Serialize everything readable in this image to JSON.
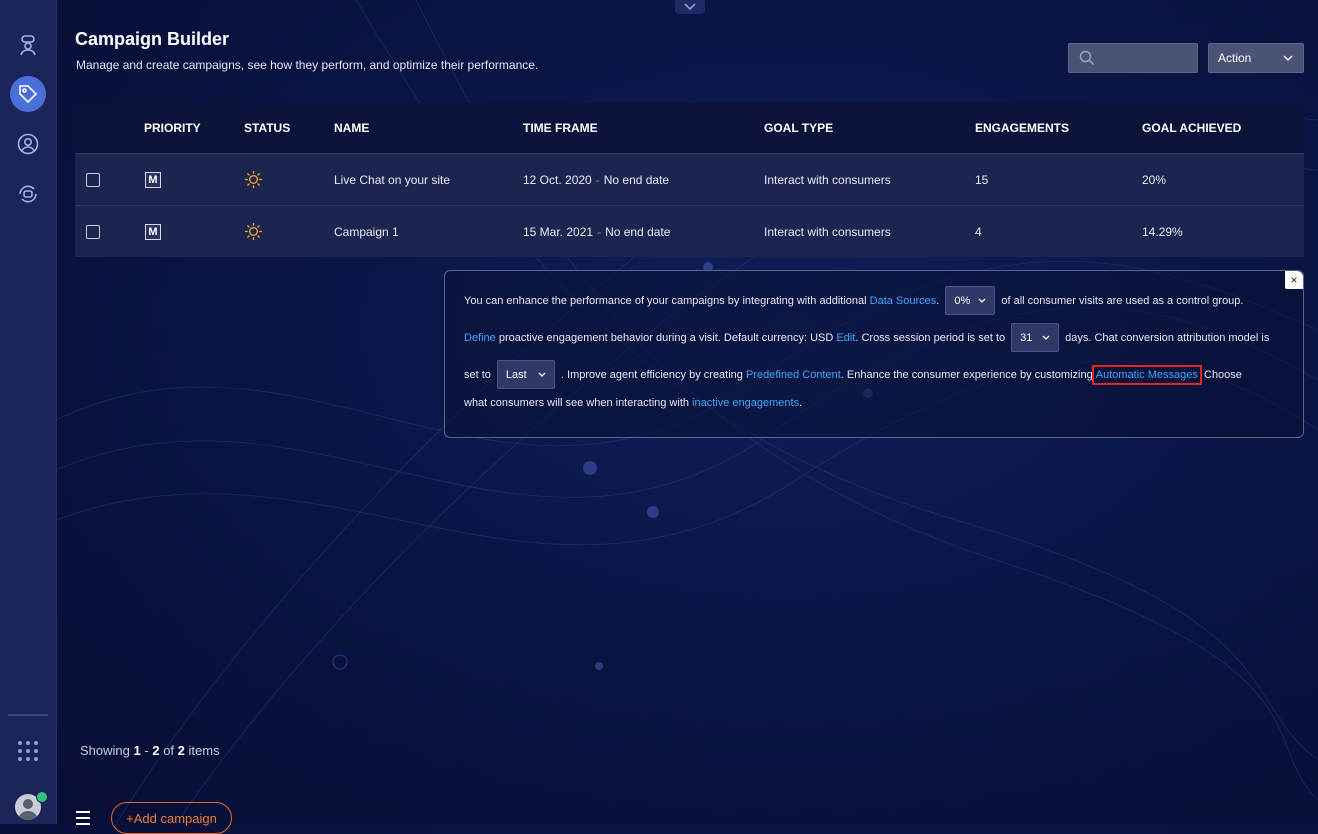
{
  "header": {
    "title": "Campaign Builder",
    "subtitle": "Manage and create campaigns, see how they perform, and optimize their performance.",
    "search_placeholder": "",
    "action_label": "Action"
  },
  "table": {
    "columns": [
      "PRIORITY",
      "STATUS",
      "NAME",
      "TIME FRAME",
      "GOAL TYPE",
      "ENGAGEMENTS",
      "GOAL ACHIEVED"
    ],
    "rows": [
      {
        "priority": "M",
        "name": "Live Chat on your site",
        "start": "12 Oct. 2020",
        "end": "No end date",
        "goal_type": "Interact with consumers",
        "engagements": "15",
        "goal_achieved": "20%"
      },
      {
        "priority": "M",
        "name": "Campaign 1",
        "start": "15 Mar. 2021",
        "end": "No end date",
        "goal_type": "Interact with consumers",
        "engagements": "4",
        "goal_achieved": "14.29%"
      }
    ]
  },
  "info": {
    "close": "×",
    "l1_text": "You can enhance the performance of your campaigns by integrating with additional",
    "l1_link": "Data Sources",
    "l1_dot": ".",
    "control_value": "0%",
    "l1_text2": "of all consumer visits are used as a control group.",
    "l2_link1": "Define",
    "l2_text1": "proactive engagement behavior during a visit. Default currency: USD",
    "l2_link2": "Edit",
    "l2_text2": ". Cross session period is set to",
    "session_value": "31",
    "l2_text3": "days. Chat conversion attribution model is",
    "l3_text1": "set to",
    "model_value": "Last",
    "l3_text2": ". Improve agent efficiency by creating",
    "l3_link1": "Predefined Content",
    "l3_text3": ". Enhance the consumer experience by customizing",
    "l3_link2": "Automatic Messages",
    "l3_text4": "Choose",
    "l4_text1": "what consumers will see when interacting with",
    "l4_link": "inactive engagements",
    "l4_dot": "."
  },
  "footer": {
    "showing_prefix": "Showing",
    "range_start": "1",
    "range_sep": "-",
    "range_end": "2",
    "of": "of",
    "total": "2",
    "items": "items",
    "add_campaign": "+Add campaign"
  },
  "colors": {
    "accent": "#3fa9f5",
    "highlight": "#e0261f",
    "add_button": "#f07a3a",
    "status_icon": "#f5a623"
  },
  "icons": {
    "sidebar": [
      "agent-icon",
      "campaigns-tag-icon",
      "user-circle-icon",
      "bot-sync-icon"
    ],
    "row_status": "sun-icon"
  }
}
